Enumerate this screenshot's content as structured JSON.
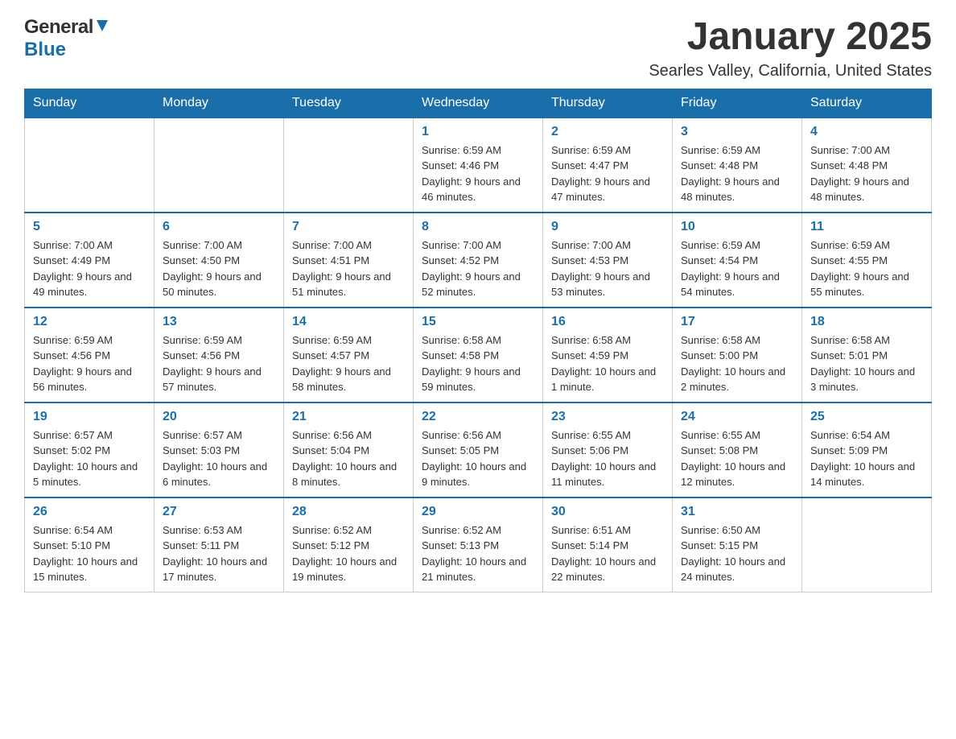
{
  "header": {
    "logo": {
      "general": "General",
      "blue": "Blue"
    },
    "title": "January 2025",
    "location": "Searles Valley, California, United States"
  },
  "calendar": {
    "days_of_week": [
      "Sunday",
      "Monday",
      "Tuesday",
      "Wednesday",
      "Thursday",
      "Friday",
      "Saturday"
    ],
    "weeks": [
      [
        {
          "day": "",
          "info": ""
        },
        {
          "day": "",
          "info": ""
        },
        {
          "day": "",
          "info": ""
        },
        {
          "day": "1",
          "info": "Sunrise: 6:59 AM\nSunset: 4:46 PM\nDaylight: 9 hours and 46 minutes."
        },
        {
          "day": "2",
          "info": "Sunrise: 6:59 AM\nSunset: 4:47 PM\nDaylight: 9 hours and 47 minutes."
        },
        {
          "day": "3",
          "info": "Sunrise: 6:59 AM\nSunset: 4:48 PM\nDaylight: 9 hours and 48 minutes."
        },
        {
          "day": "4",
          "info": "Sunrise: 7:00 AM\nSunset: 4:48 PM\nDaylight: 9 hours and 48 minutes."
        }
      ],
      [
        {
          "day": "5",
          "info": "Sunrise: 7:00 AM\nSunset: 4:49 PM\nDaylight: 9 hours and 49 minutes."
        },
        {
          "day": "6",
          "info": "Sunrise: 7:00 AM\nSunset: 4:50 PM\nDaylight: 9 hours and 50 minutes."
        },
        {
          "day": "7",
          "info": "Sunrise: 7:00 AM\nSunset: 4:51 PM\nDaylight: 9 hours and 51 minutes."
        },
        {
          "day": "8",
          "info": "Sunrise: 7:00 AM\nSunset: 4:52 PM\nDaylight: 9 hours and 52 minutes."
        },
        {
          "day": "9",
          "info": "Sunrise: 7:00 AM\nSunset: 4:53 PM\nDaylight: 9 hours and 53 minutes."
        },
        {
          "day": "10",
          "info": "Sunrise: 6:59 AM\nSunset: 4:54 PM\nDaylight: 9 hours and 54 minutes."
        },
        {
          "day": "11",
          "info": "Sunrise: 6:59 AM\nSunset: 4:55 PM\nDaylight: 9 hours and 55 minutes."
        }
      ],
      [
        {
          "day": "12",
          "info": "Sunrise: 6:59 AM\nSunset: 4:56 PM\nDaylight: 9 hours and 56 minutes."
        },
        {
          "day": "13",
          "info": "Sunrise: 6:59 AM\nSunset: 4:56 PM\nDaylight: 9 hours and 57 minutes."
        },
        {
          "day": "14",
          "info": "Sunrise: 6:59 AM\nSunset: 4:57 PM\nDaylight: 9 hours and 58 minutes."
        },
        {
          "day": "15",
          "info": "Sunrise: 6:58 AM\nSunset: 4:58 PM\nDaylight: 9 hours and 59 minutes."
        },
        {
          "day": "16",
          "info": "Sunrise: 6:58 AM\nSunset: 4:59 PM\nDaylight: 10 hours and 1 minute."
        },
        {
          "day": "17",
          "info": "Sunrise: 6:58 AM\nSunset: 5:00 PM\nDaylight: 10 hours and 2 minutes."
        },
        {
          "day": "18",
          "info": "Sunrise: 6:58 AM\nSunset: 5:01 PM\nDaylight: 10 hours and 3 minutes."
        }
      ],
      [
        {
          "day": "19",
          "info": "Sunrise: 6:57 AM\nSunset: 5:02 PM\nDaylight: 10 hours and 5 minutes."
        },
        {
          "day": "20",
          "info": "Sunrise: 6:57 AM\nSunset: 5:03 PM\nDaylight: 10 hours and 6 minutes."
        },
        {
          "day": "21",
          "info": "Sunrise: 6:56 AM\nSunset: 5:04 PM\nDaylight: 10 hours and 8 minutes."
        },
        {
          "day": "22",
          "info": "Sunrise: 6:56 AM\nSunset: 5:05 PM\nDaylight: 10 hours and 9 minutes."
        },
        {
          "day": "23",
          "info": "Sunrise: 6:55 AM\nSunset: 5:06 PM\nDaylight: 10 hours and 11 minutes."
        },
        {
          "day": "24",
          "info": "Sunrise: 6:55 AM\nSunset: 5:08 PM\nDaylight: 10 hours and 12 minutes."
        },
        {
          "day": "25",
          "info": "Sunrise: 6:54 AM\nSunset: 5:09 PM\nDaylight: 10 hours and 14 minutes."
        }
      ],
      [
        {
          "day": "26",
          "info": "Sunrise: 6:54 AM\nSunset: 5:10 PM\nDaylight: 10 hours and 15 minutes."
        },
        {
          "day": "27",
          "info": "Sunrise: 6:53 AM\nSunset: 5:11 PM\nDaylight: 10 hours and 17 minutes."
        },
        {
          "day": "28",
          "info": "Sunrise: 6:52 AM\nSunset: 5:12 PM\nDaylight: 10 hours and 19 minutes."
        },
        {
          "day": "29",
          "info": "Sunrise: 6:52 AM\nSunset: 5:13 PM\nDaylight: 10 hours and 21 minutes."
        },
        {
          "day": "30",
          "info": "Sunrise: 6:51 AM\nSunset: 5:14 PM\nDaylight: 10 hours and 22 minutes."
        },
        {
          "day": "31",
          "info": "Sunrise: 6:50 AM\nSunset: 5:15 PM\nDaylight: 10 hours and 24 minutes."
        },
        {
          "day": "",
          "info": ""
        }
      ]
    ]
  }
}
